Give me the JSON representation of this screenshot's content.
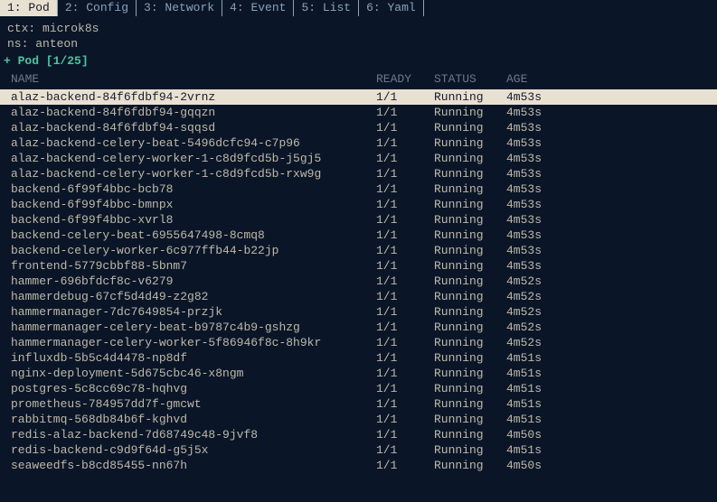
{
  "tabs": [
    {
      "label": "1: Pod",
      "active": true
    },
    {
      "label": "2: Config",
      "active": false
    },
    {
      "label": "3: Network",
      "active": false
    },
    {
      "label": "4: Event",
      "active": false
    },
    {
      "label": "5: List",
      "active": false
    },
    {
      "label": "6: Yaml",
      "active": false
    }
  ],
  "context": {
    "ctx_label": "ctx:",
    "ctx_value": "microk8s",
    "ns_label": "ns:",
    "ns_value": "anteon"
  },
  "section": {
    "title": "+ Pod [1/25]"
  },
  "columns": {
    "name": "NAME",
    "ready": "READY",
    "status": "STATUS",
    "age": "AGE"
  },
  "pods": [
    {
      "name": "alaz-backend-84f6fdbf94-2vrnz",
      "ready": "1/1",
      "status": "Running",
      "age": "4m53s",
      "selected": true
    },
    {
      "name": "alaz-backend-84f6fdbf94-gqqzn",
      "ready": "1/1",
      "status": "Running",
      "age": "4m53s"
    },
    {
      "name": "alaz-backend-84f6fdbf94-sqqsd",
      "ready": "1/1",
      "status": "Running",
      "age": "4m53s"
    },
    {
      "name": "alaz-backend-celery-beat-5496dcfc94-c7p96",
      "ready": "1/1",
      "status": "Running",
      "age": "4m53s"
    },
    {
      "name": "alaz-backend-celery-worker-1-c8d9fcd5b-j5gj5",
      "ready": "1/1",
      "status": "Running",
      "age": "4m53s"
    },
    {
      "name": "alaz-backend-celery-worker-1-c8d9fcd5b-rxw9g",
      "ready": "1/1",
      "status": "Running",
      "age": "4m53s"
    },
    {
      "name": "backend-6f99f4bbc-bcb78",
      "ready": "1/1",
      "status": "Running",
      "age": "4m53s"
    },
    {
      "name": "backend-6f99f4bbc-bmnpx",
      "ready": "1/1",
      "status": "Running",
      "age": "4m53s"
    },
    {
      "name": "backend-6f99f4bbc-xvrl8",
      "ready": "1/1",
      "status": "Running",
      "age": "4m53s"
    },
    {
      "name": "backend-celery-beat-6955647498-8cmq8",
      "ready": "1/1",
      "status": "Running",
      "age": "4m53s"
    },
    {
      "name": "backend-celery-worker-6c977ffb44-b22jp",
      "ready": "1/1",
      "status": "Running",
      "age": "4m53s"
    },
    {
      "name": "frontend-5779cbbf88-5bnm7",
      "ready": "1/1",
      "status": "Running",
      "age": "4m53s"
    },
    {
      "name": "hammer-696bfdcf8c-v6279",
      "ready": "1/1",
      "status": "Running",
      "age": "4m52s"
    },
    {
      "name": "hammerdebug-67cf5d4d49-z2g82",
      "ready": "1/1",
      "status": "Running",
      "age": "4m52s"
    },
    {
      "name": "hammermanager-7dc7649854-przjk",
      "ready": "1/1",
      "status": "Running",
      "age": "4m52s"
    },
    {
      "name": "hammermanager-celery-beat-b9787c4b9-gshzg",
      "ready": "1/1",
      "status": "Running",
      "age": "4m52s"
    },
    {
      "name": "hammermanager-celery-worker-5f86946f8c-8h9kr",
      "ready": "1/1",
      "status": "Running",
      "age": "4m52s"
    },
    {
      "name": "influxdb-5b5c4d4478-np8df",
      "ready": "1/1",
      "status": "Running",
      "age": "4m51s"
    },
    {
      "name": "nginx-deployment-5d675cbc46-x8ngm",
      "ready": "1/1",
      "status": "Running",
      "age": "4m51s"
    },
    {
      "name": "postgres-5c8cc69c78-hqhvg",
      "ready": "1/1",
      "status": "Running",
      "age": "4m51s"
    },
    {
      "name": "prometheus-784957dd7f-gmcwt",
      "ready": "1/1",
      "status": "Running",
      "age": "4m51s"
    },
    {
      "name": "rabbitmq-568db84b6f-kghvd",
      "ready": "1/1",
      "status": "Running",
      "age": "4m51s"
    },
    {
      "name": "redis-alaz-backend-7d68749c48-9jvf8",
      "ready": "1/1",
      "status": "Running",
      "age": "4m50s"
    },
    {
      "name": "redis-backend-c9d9f64d-g5j5x",
      "ready": "1/1",
      "status": "Running",
      "age": "4m51s"
    },
    {
      "name": "seaweedfs-b8cd85455-nn67h",
      "ready": "1/1",
      "status": "Running",
      "age": "4m50s"
    }
  ]
}
